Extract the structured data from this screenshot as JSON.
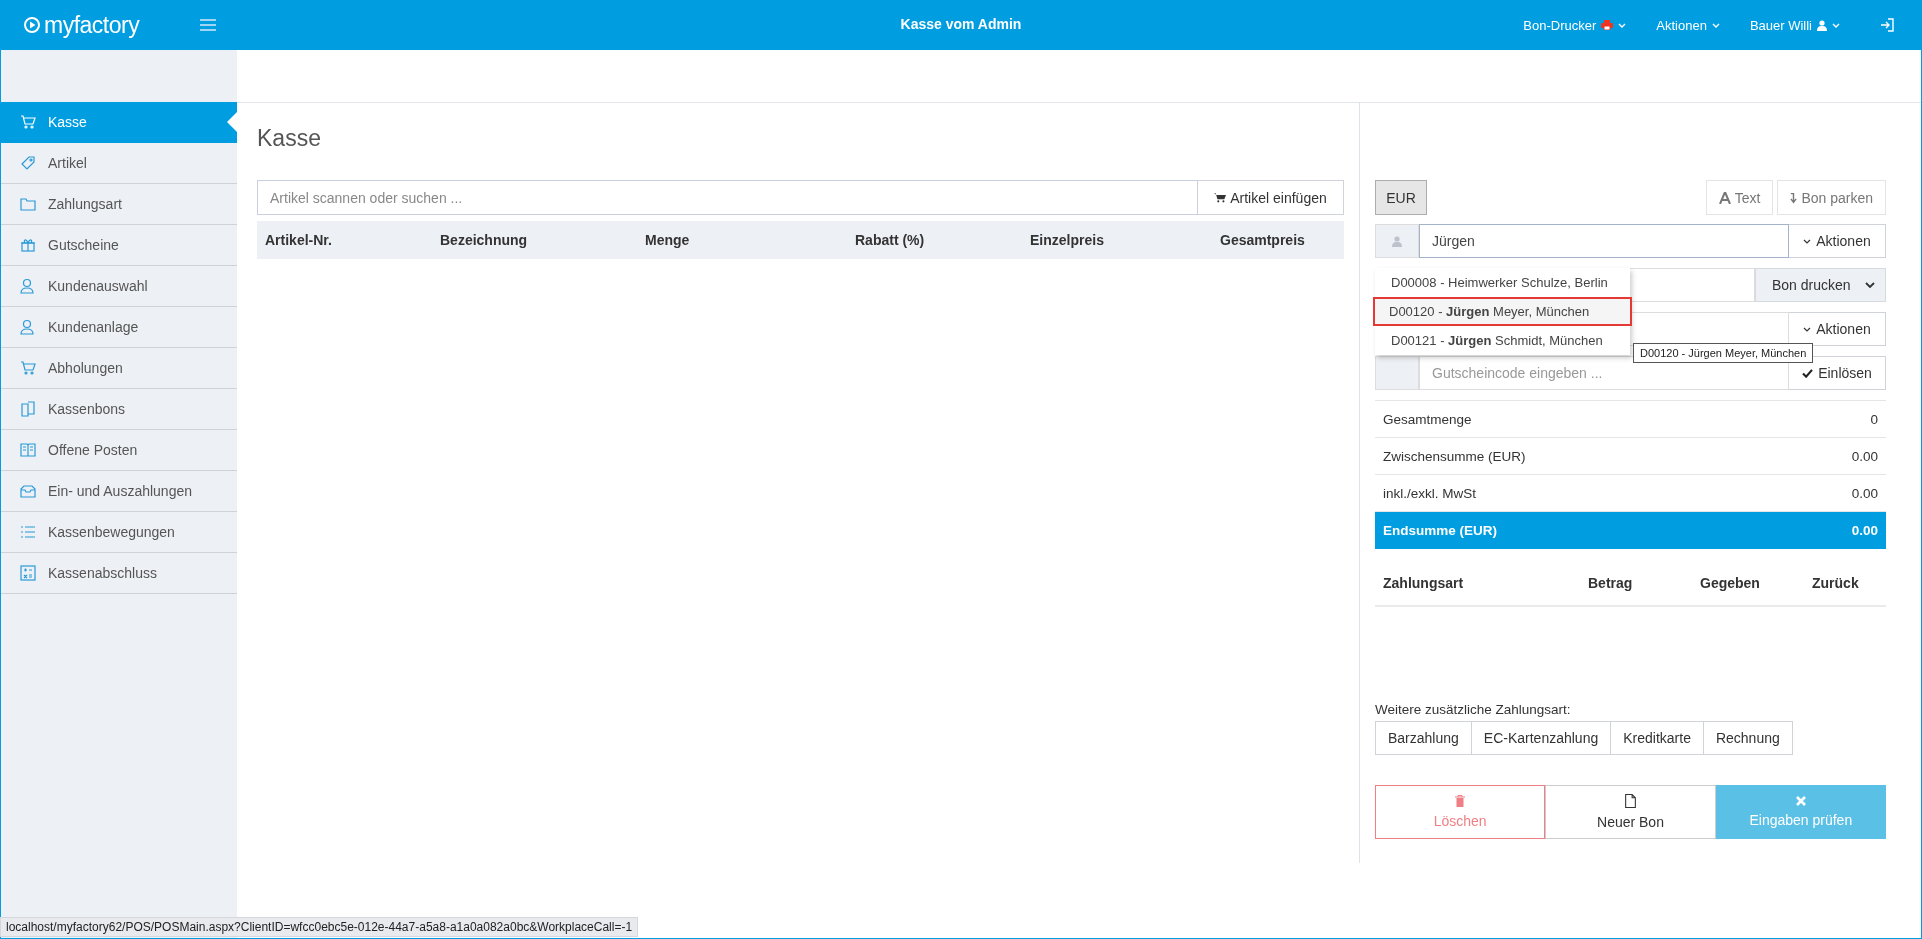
{
  "header": {
    "logo": "myfactory",
    "title": "Kasse vom Admin",
    "menus": [
      {
        "label": "Bon-Drucker",
        "kind": "printer"
      },
      {
        "label": "Aktionen",
        "kind": "plain"
      },
      {
        "label": "Bauer Willi",
        "kind": "user"
      }
    ]
  },
  "sidebar": {
    "items": [
      {
        "label": "Kasse",
        "selected": true
      },
      {
        "label": "Artikel",
        "selected": false
      },
      {
        "label": "Zahlungsart",
        "selected": false
      },
      {
        "label": "Gutscheine",
        "selected": false
      },
      {
        "label": "Kundenauswahl",
        "selected": false
      },
      {
        "label": "Kundenanlage",
        "selected": false
      },
      {
        "label": "Abholungen",
        "selected": false
      },
      {
        "label": "Kassenbons",
        "selected": false
      },
      {
        "label": "Offene Posten",
        "selected": false
      },
      {
        "label": "Ein- und Auszahlungen",
        "selected": false
      },
      {
        "label": "Kassenbewegungen",
        "selected": false
      },
      {
        "label": "Kassenabschluss",
        "selected": false
      }
    ]
  },
  "page_title": "Kasse",
  "article_search": {
    "placeholder": "Artikel scannen oder suchen ...",
    "button": "Artikel einfügen"
  },
  "table": {
    "columns": [
      "Artikel-Nr.",
      "Bezeichnung",
      "Menge",
      "Rabatt (%)",
      "Einzelpreis",
      "Gesamtpreis"
    ]
  },
  "receipt": {
    "currency": "EUR",
    "tools": [
      {
        "label": "Text",
        "kind": "text"
      },
      {
        "label": "Bon parken",
        "kind": "park"
      }
    ],
    "customer": {
      "value": "Jürgen",
      "button": "Aktionen"
    },
    "print_select": "Bon drucken",
    "second_actions": "Aktionen",
    "voucher": {
      "placeholder": "Gutscheincode eingeben ...",
      "button": "Einlösen"
    },
    "suggestions": [
      {
        "text": "D00008 - Heimwerker Schulze, Berlin",
        "selected": false
      },
      {
        "text": "D00120 - **Jürgen** Meyer, München",
        "selected": true
      },
      {
        "text": "D00121 - **Jürgen** Schmidt, München",
        "selected": false
      }
    ],
    "tooltip": "D00120 - Jürgen Meyer, München",
    "totals": [
      {
        "label": "Gesamtmenge",
        "value": "0",
        "kind": "line"
      },
      {
        "label": "Zwischensumme (EUR)",
        "value": "0.00",
        "kind": "line"
      },
      {
        "label": "inkl./exkl. MwSt",
        "value": "0.00",
        "kind": "line"
      },
      {
        "label": "Endsumme (EUR)",
        "value": "0.00",
        "kind": "total"
      }
    ],
    "payment_columns": [
      "Zahlungsart",
      "Betrag",
      "Gegeben",
      "Zurück"
    ],
    "extra_label": "Weitere zusätzliche Zahlungsart:",
    "extra_methods": [
      "Barzahlung",
      "EC-Kartenzahlung",
      "Kreditkarte",
      "Rechnung"
    ],
    "actions": [
      {
        "label": "Löschen",
        "kind": "delete"
      },
      {
        "label": "Neuer Bon",
        "kind": "new"
      },
      {
        "label": "Eingaben prüfen",
        "kind": "check"
      }
    ]
  },
  "status_bar": "localhost/myfactory62/POS/POSMain.aspx?ClientID=wfcc0ebc5e-012e-44a7-a5a8-a1a0a082a0bc&WorkplaceCall=-1"
}
